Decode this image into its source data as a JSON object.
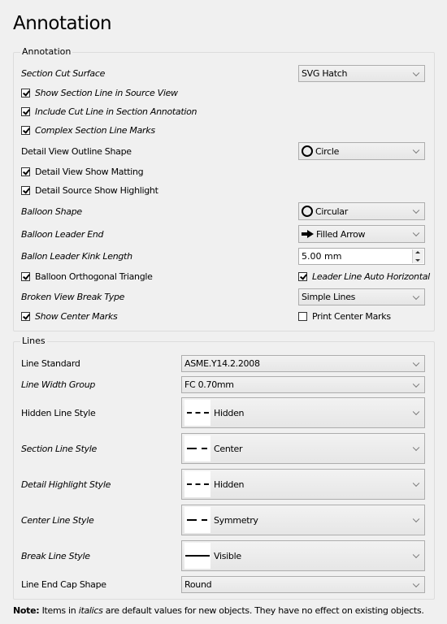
{
  "page_title": "Annotation",
  "annotation_group": {
    "title": "Annotation",
    "section_cut_surface": {
      "label": "Section Cut Surface",
      "value": "SVG Hatch"
    },
    "show_section_line": {
      "label": "Show Section Line in Source View",
      "checked": true
    },
    "include_cut_line": {
      "label": "Include Cut Line in Section Annotation",
      "checked": true
    },
    "complex_section_marks": {
      "label": "Complex Section Line Marks",
      "checked": true
    },
    "detail_view_outline": {
      "label": "Detail View Outline Shape",
      "value": "Circle",
      "icon": "circle-icon"
    },
    "detail_view_matting": {
      "label": "Detail View Show Matting",
      "checked": true
    },
    "detail_source_highlight": {
      "label": "Detail Source Show Highlight",
      "checked": true
    },
    "balloon_shape": {
      "label": "Balloon Shape",
      "value": "Circular",
      "icon": "circle-icon"
    },
    "balloon_leader_end": {
      "label": "Balloon Leader End",
      "value": "Filled Arrow",
      "icon": "filled-arrow-icon"
    },
    "balloon_kink_length": {
      "label": "Ballon Leader Kink Length",
      "value": "5.00 mm"
    },
    "balloon_orthogonal": {
      "label": "Balloon Orthogonal Triangle",
      "checked": true
    },
    "leader_auto_horizontal": {
      "label": "Leader Line Auto Horizontal",
      "checked": true
    },
    "broken_view_break": {
      "label": "Broken View Break Type",
      "value": "Simple Lines"
    },
    "show_center_marks": {
      "label": "Show Center Marks",
      "checked": true
    },
    "print_center_marks": {
      "label": "Print Center Marks",
      "checked": false
    }
  },
  "lines_group": {
    "title": "Lines",
    "line_standard": {
      "label": "Line Standard",
      "value": "ASME.Y14.2.2008"
    },
    "line_width_group": {
      "label": "Line Width Group",
      "value": "FC 0.70mm"
    },
    "hidden_line_style": {
      "label": "Hidden Line Style",
      "value": "Hidden"
    },
    "section_line_style": {
      "label": "Section Line Style",
      "value": "Center"
    },
    "detail_highlight_style": {
      "label": "Detail Highlight Style",
      "value": "Hidden"
    },
    "center_line_style": {
      "label": "Center Line Style",
      "value": "Symmetry"
    },
    "break_line_style": {
      "label": "Break Line Style",
      "value": "Visible"
    },
    "line_end_cap": {
      "label": "Line End Cap Shape",
      "value": "Round"
    }
  },
  "note": {
    "bold": "Note:",
    "pre": " Items in ",
    "italic": "italics",
    "post": " are default values for new objects. They have no effect on existing objects."
  }
}
